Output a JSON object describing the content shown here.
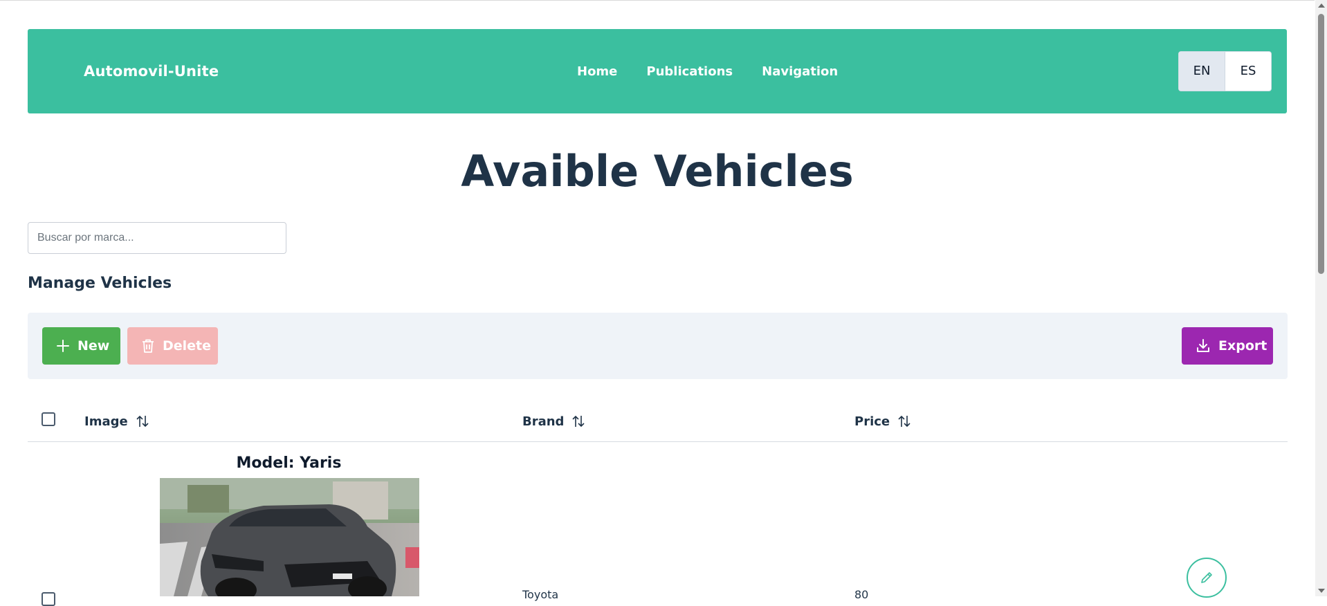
{
  "header": {
    "brand": "Automovil-Unite",
    "nav": [
      "Home",
      "Publications",
      "Navigation"
    ],
    "languages": [
      "EN",
      "ES"
    ],
    "active_language": "EN"
  },
  "page_title": "Avaible Vehicles",
  "search": {
    "placeholder": "Buscar por marca...",
    "value": ""
  },
  "section_title": "Manage Vehicles",
  "toolbar": {
    "new_label": "New",
    "delete_label": "Delete",
    "export_label": "Export"
  },
  "table": {
    "columns": [
      "Image",
      "Brand",
      "Price"
    ],
    "rows": [
      {
        "model": "Model: Yaris",
        "brand": "Toyota",
        "price": "80"
      }
    ]
  },
  "colors": {
    "header": "#3bbf9f",
    "new": "#4caf50",
    "delete": "#f4b5b5",
    "export": "#9c27b0",
    "title": "#1f3347"
  },
  "icons": [
    "plus-icon",
    "trash-icon",
    "download-icon",
    "sort-icon",
    "pencil-icon"
  ]
}
